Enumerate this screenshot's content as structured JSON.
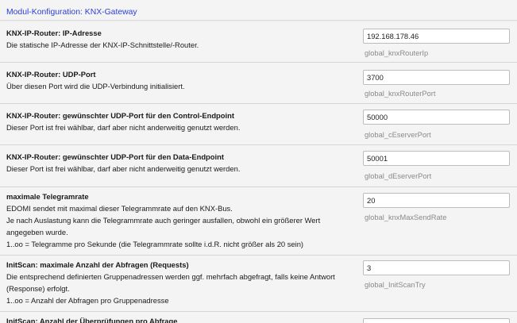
{
  "header": {
    "title": "Modul-Konfiguration: KNX-Gateway"
  },
  "settings": [
    {
      "title": "KNX-IP-Router: IP-Adresse",
      "lines": [
        "Die statische IP-Adresse der KNX-IP-Schnittstelle/-Router."
      ],
      "value": "192.168.178.46",
      "var": "global_knxRouterIp"
    },
    {
      "title": "KNX-IP-Router: UDP-Port",
      "lines": [
        "Über diesen Port wird die UDP-Verbindung initialisiert."
      ],
      "value": "3700",
      "var": "global_knxRouterPort"
    },
    {
      "title": "KNX-IP-Router: gewünschter UDP-Port für den Control-Endpoint",
      "lines": [
        "Dieser Port ist frei wählbar, darf aber nicht anderweitig genutzt werden."
      ],
      "value": "50000",
      "var": "global_cEserverPort"
    },
    {
      "title": "KNX-IP-Router: gewünschter UDP-Port für den Data-Endpoint",
      "lines": [
        "Dieser Port ist frei wählbar, darf aber nicht anderweitig genutzt werden."
      ],
      "value": "50001",
      "var": "global_dEserverPort"
    },
    {
      "title": "maximale Telegramrate",
      "lines": [
        "EDOMI sendet mit maximal dieser Telegrammrate auf den KNX-Bus.",
        "Je nach Auslastung kann die Telegrammrate auch geringer ausfallen, obwohl ein größerer Wert",
        "angegeben wurde.",
        "1..oo = Telegramme pro Sekunde (die Telegrammrate sollte i.d.R. nicht größer als 20 sein)"
      ],
      "value": "20",
      "var": "global_knxMaxSendRate"
    },
    {
      "title": "InitScan: maximale Anzahl der Abfragen (Requests)",
      "lines": [
        "Die entsprechend definierten Gruppenadressen werden ggf. mehrfach abgefragt, falls keine Antwort",
        "(Response) erfolgt.",
        "1..oo = Anzahl der Abfragen pro Gruppenadresse"
      ],
      "value": "3",
      "var": "global_InitScanTry"
    },
    {
      "title": "InitScan: Anzahl der Überprüfungen pro Abfrage",
      "lines": [],
      "value": "",
      "var": ""
    }
  ]
}
